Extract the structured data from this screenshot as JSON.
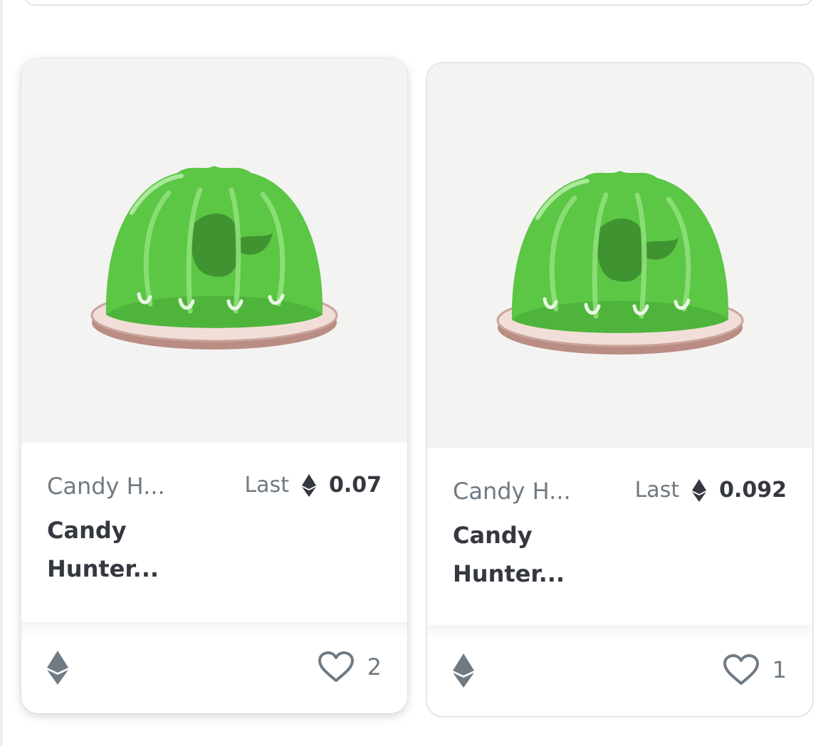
{
  "cards": [
    {
      "collection": "Candy H...",
      "name": "Candy Hunter...",
      "price_label": "Last",
      "price_value": "0.07",
      "likes": "2",
      "image_icon": "green-jelly-image",
      "chain_icon": "ethereum-icon"
    },
    {
      "collection": "Candy H...",
      "name": "Candy Hunter...",
      "price_label": "Last",
      "price_value": "0.092",
      "likes": "1",
      "image_icon": "green-jelly-image",
      "chain_icon": "ethereum-icon"
    }
  ],
  "colors": {
    "jelly_green": "#5cc645",
    "text_muted": "#707a83",
    "text_dark": "#353840",
    "media_bg": "#f3f3f2"
  }
}
